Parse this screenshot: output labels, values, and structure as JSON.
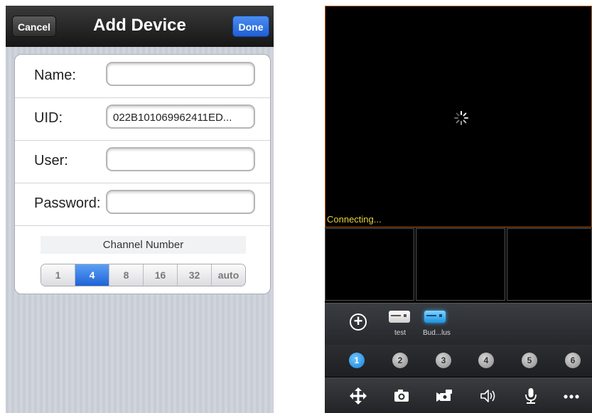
{
  "add_device": {
    "cancel_label": "Cancel",
    "title": "Add Device",
    "done_label": "Done",
    "fields": [
      {
        "label": "Name:",
        "value": ""
      },
      {
        "label": "UID:",
        "value": "022B101069962411ED..."
      },
      {
        "label": "User:",
        "value": ""
      },
      {
        "label": "Password:",
        "value": ""
      }
    ],
    "channel_title": "Channel Number",
    "channel_options": [
      "1",
      "4",
      "8",
      "16",
      "32",
      "auto"
    ],
    "channel_selected": "4"
  },
  "live_view": {
    "status_text": "Connecting...",
    "devices": [
      {
        "label": "test",
        "icon": "dvr-device-icon",
        "color": "#e9e9e9"
      },
      {
        "label": "Bud...lus",
        "icon": "dvr-device-icon",
        "color": "#27a7ee"
      }
    ],
    "channels": [
      "1",
      "2",
      "3",
      "4",
      "5",
      "6"
    ],
    "active_channel": "1",
    "toolbar_icons": [
      "ptz-move-icon",
      "snapshot-camera-icon",
      "record-video-icon",
      "speaker-icon",
      "microphone-icon",
      "more-icon"
    ],
    "colors": {
      "status": "#e8d33a",
      "active_border": "#b3611f",
      "accent": "#1f62d6"
    }
  }
}
